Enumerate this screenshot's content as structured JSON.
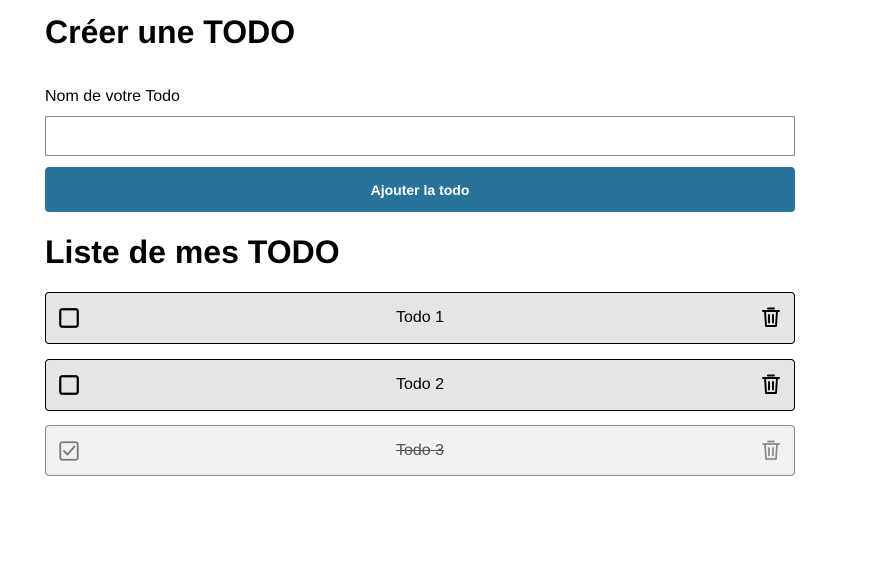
{
  "create_section": {
    "title": "Créer une TODO",
    "field_label": "Nom de votre Todo",
    "input_value": "",
    "input_placeholder": "",
    "add_button_label": "Ajouter la todo",
    "accent_color": "#287399"
  },
  "list_section": {
    "title": "Liste de mes TODO",
    "items": [
      {
        "label": "Todo 1",
        "done": false,
        "checkbox_icon": "empty-checkbox-icon",
        "delete_icon": "trash-icon"
      },
      {
        "label": "Todo 2",
        "done": false,
        "checkbox_icon": "empty-checkbox-icon",
        "delete_icon": "trash-icon"
      },
      {
        "label": "Todo 3",
        "done": true,
        "checkbox_icon": "checked-checkbox-icon",
        "delete_icon": "trash-icon"
      }
    ]
  }
}
